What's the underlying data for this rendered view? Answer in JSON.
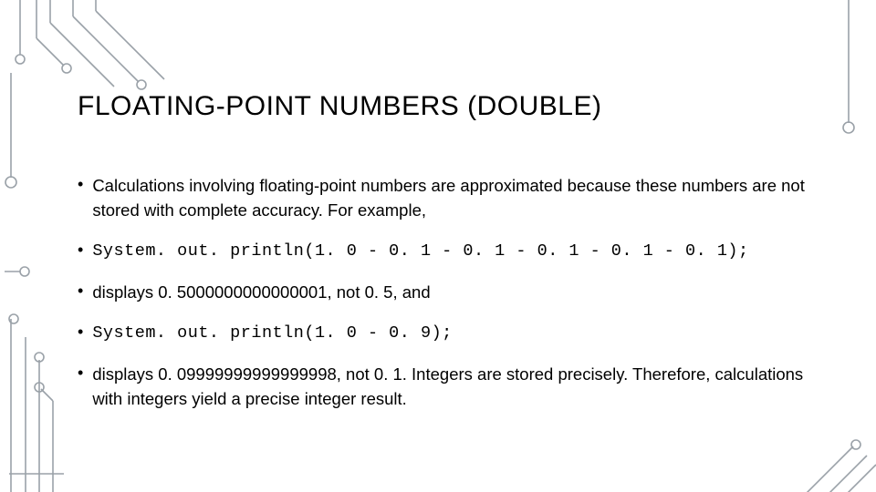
{
  "slide": {
    "title": "FLOATING-POINT NUMBERS (DOUBLE)",
    "bullets": [
      {
        "type": "text",
        "value": "Calculations involving floating-point numbers are approximated because these numbers are not stored with complete accuracy. For example,"
      },
      {
        "type": "code",
        "value": "System. out. println(1. 0 - 0. 1 - 0. 1 - 0. 1 - 0. 1 - 0. 1);"
      },
      {
        "type": "text",
        "value": "displays 0. 5000000000000001, not 0. 5, and"
      },
      {
        "type": "code",
        "value": "System. out. println(1. 0 - 0. 9);"
      },
      {
        "type": "text",
        "value": "displays 0. 09999999999999998, not 0. 1. Integers are stored precisely. Therefore, calculations with integers yield a precise integer result."
      }
    ]
  }
}
